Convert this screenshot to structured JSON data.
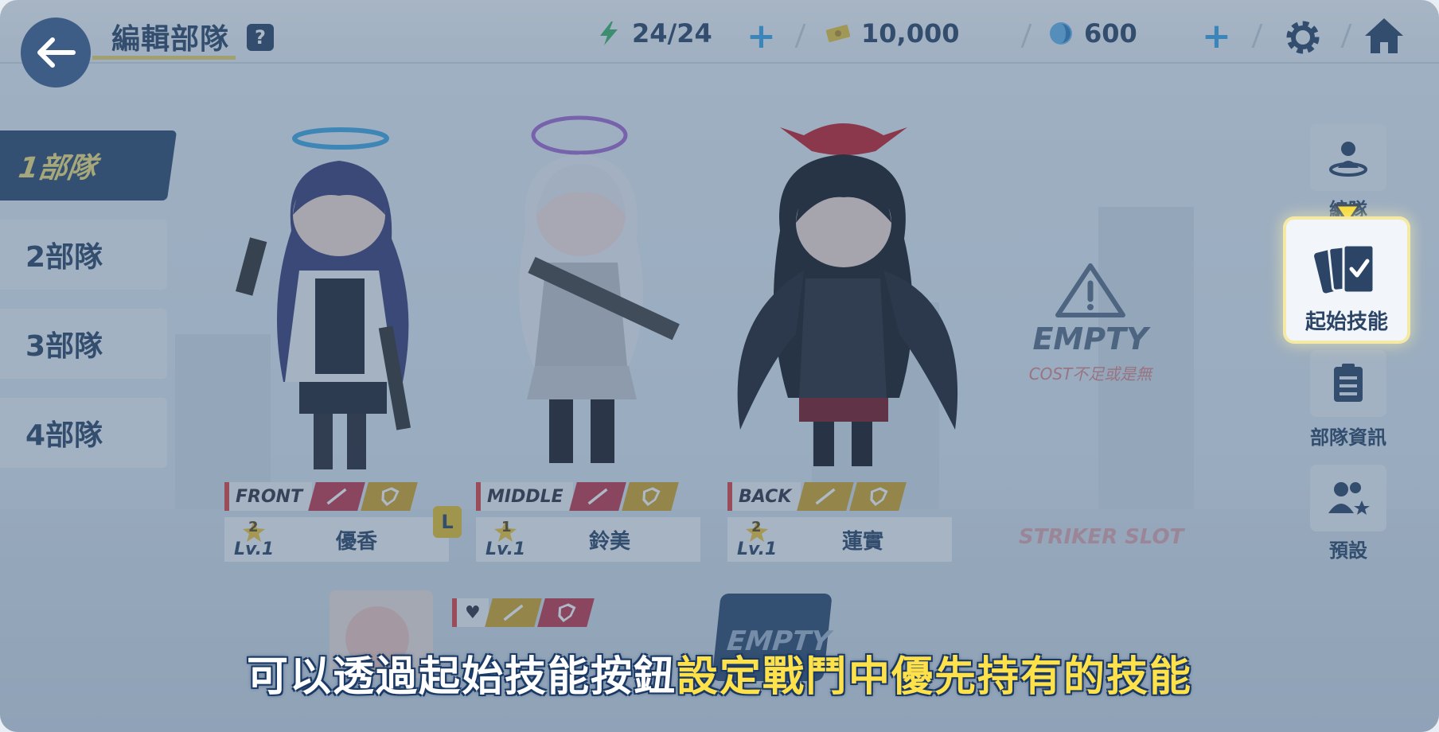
{
  "header": {
    "title": "編輯部隊",
    "help_label": "?",
    "stamina": "24/24",
    "credits": "10,000",
    "gems": "600",
    "plus_label": "+"
  },
  "squads": [
    {
      "label": "1部隊",
      "active": true
    },
    {
      "label": "2部隊",
      "active": false
    },
    {
      "label": "3部隊",
      "active": false
    },
    {
      "label": "4部隊",
      "active": false
    }
  ],
  "characters": [
    {
      "position": "FRONT",
      "star": "2",
      "level": "Lv.1",
      "name": "優香",
      "leader_badge": "L"
    },
    {
      "position": "MIDDLE",
      "star": "1",
      "level": "Lv.1",
      "name": "鈴美"
    },
    {
      "position": "BACK",
      "star": "2",
      "level": "Lv.1",
      "name": "蓮實"
    }
  ],
  "empty_slot": {
    "label": "EMPTY",
    "sub": "COST不足或是無",
    "striker": "STRIKER SLOT"
  },
  "special": {
    "empty_label": "EMPTY"
  },
  "side_menu": {
    "top_label": "編隊",
    "highlight_label": "起始技能",
    "info_label": "部隊資訊",
    "preset_label": "預設"
  },
  "subtitle": {
    "part1": "可以透過起始技能按鈕",
    "part2": "設定戰鬥中優先持有的技能"
  },
  "colors": {
    "accent_yellow": "#ffe14a",
    "navy": "#2c4566",
    "atk_red": "#c23a4a",
    "def_gold": "#d4a82a"
  }
}
